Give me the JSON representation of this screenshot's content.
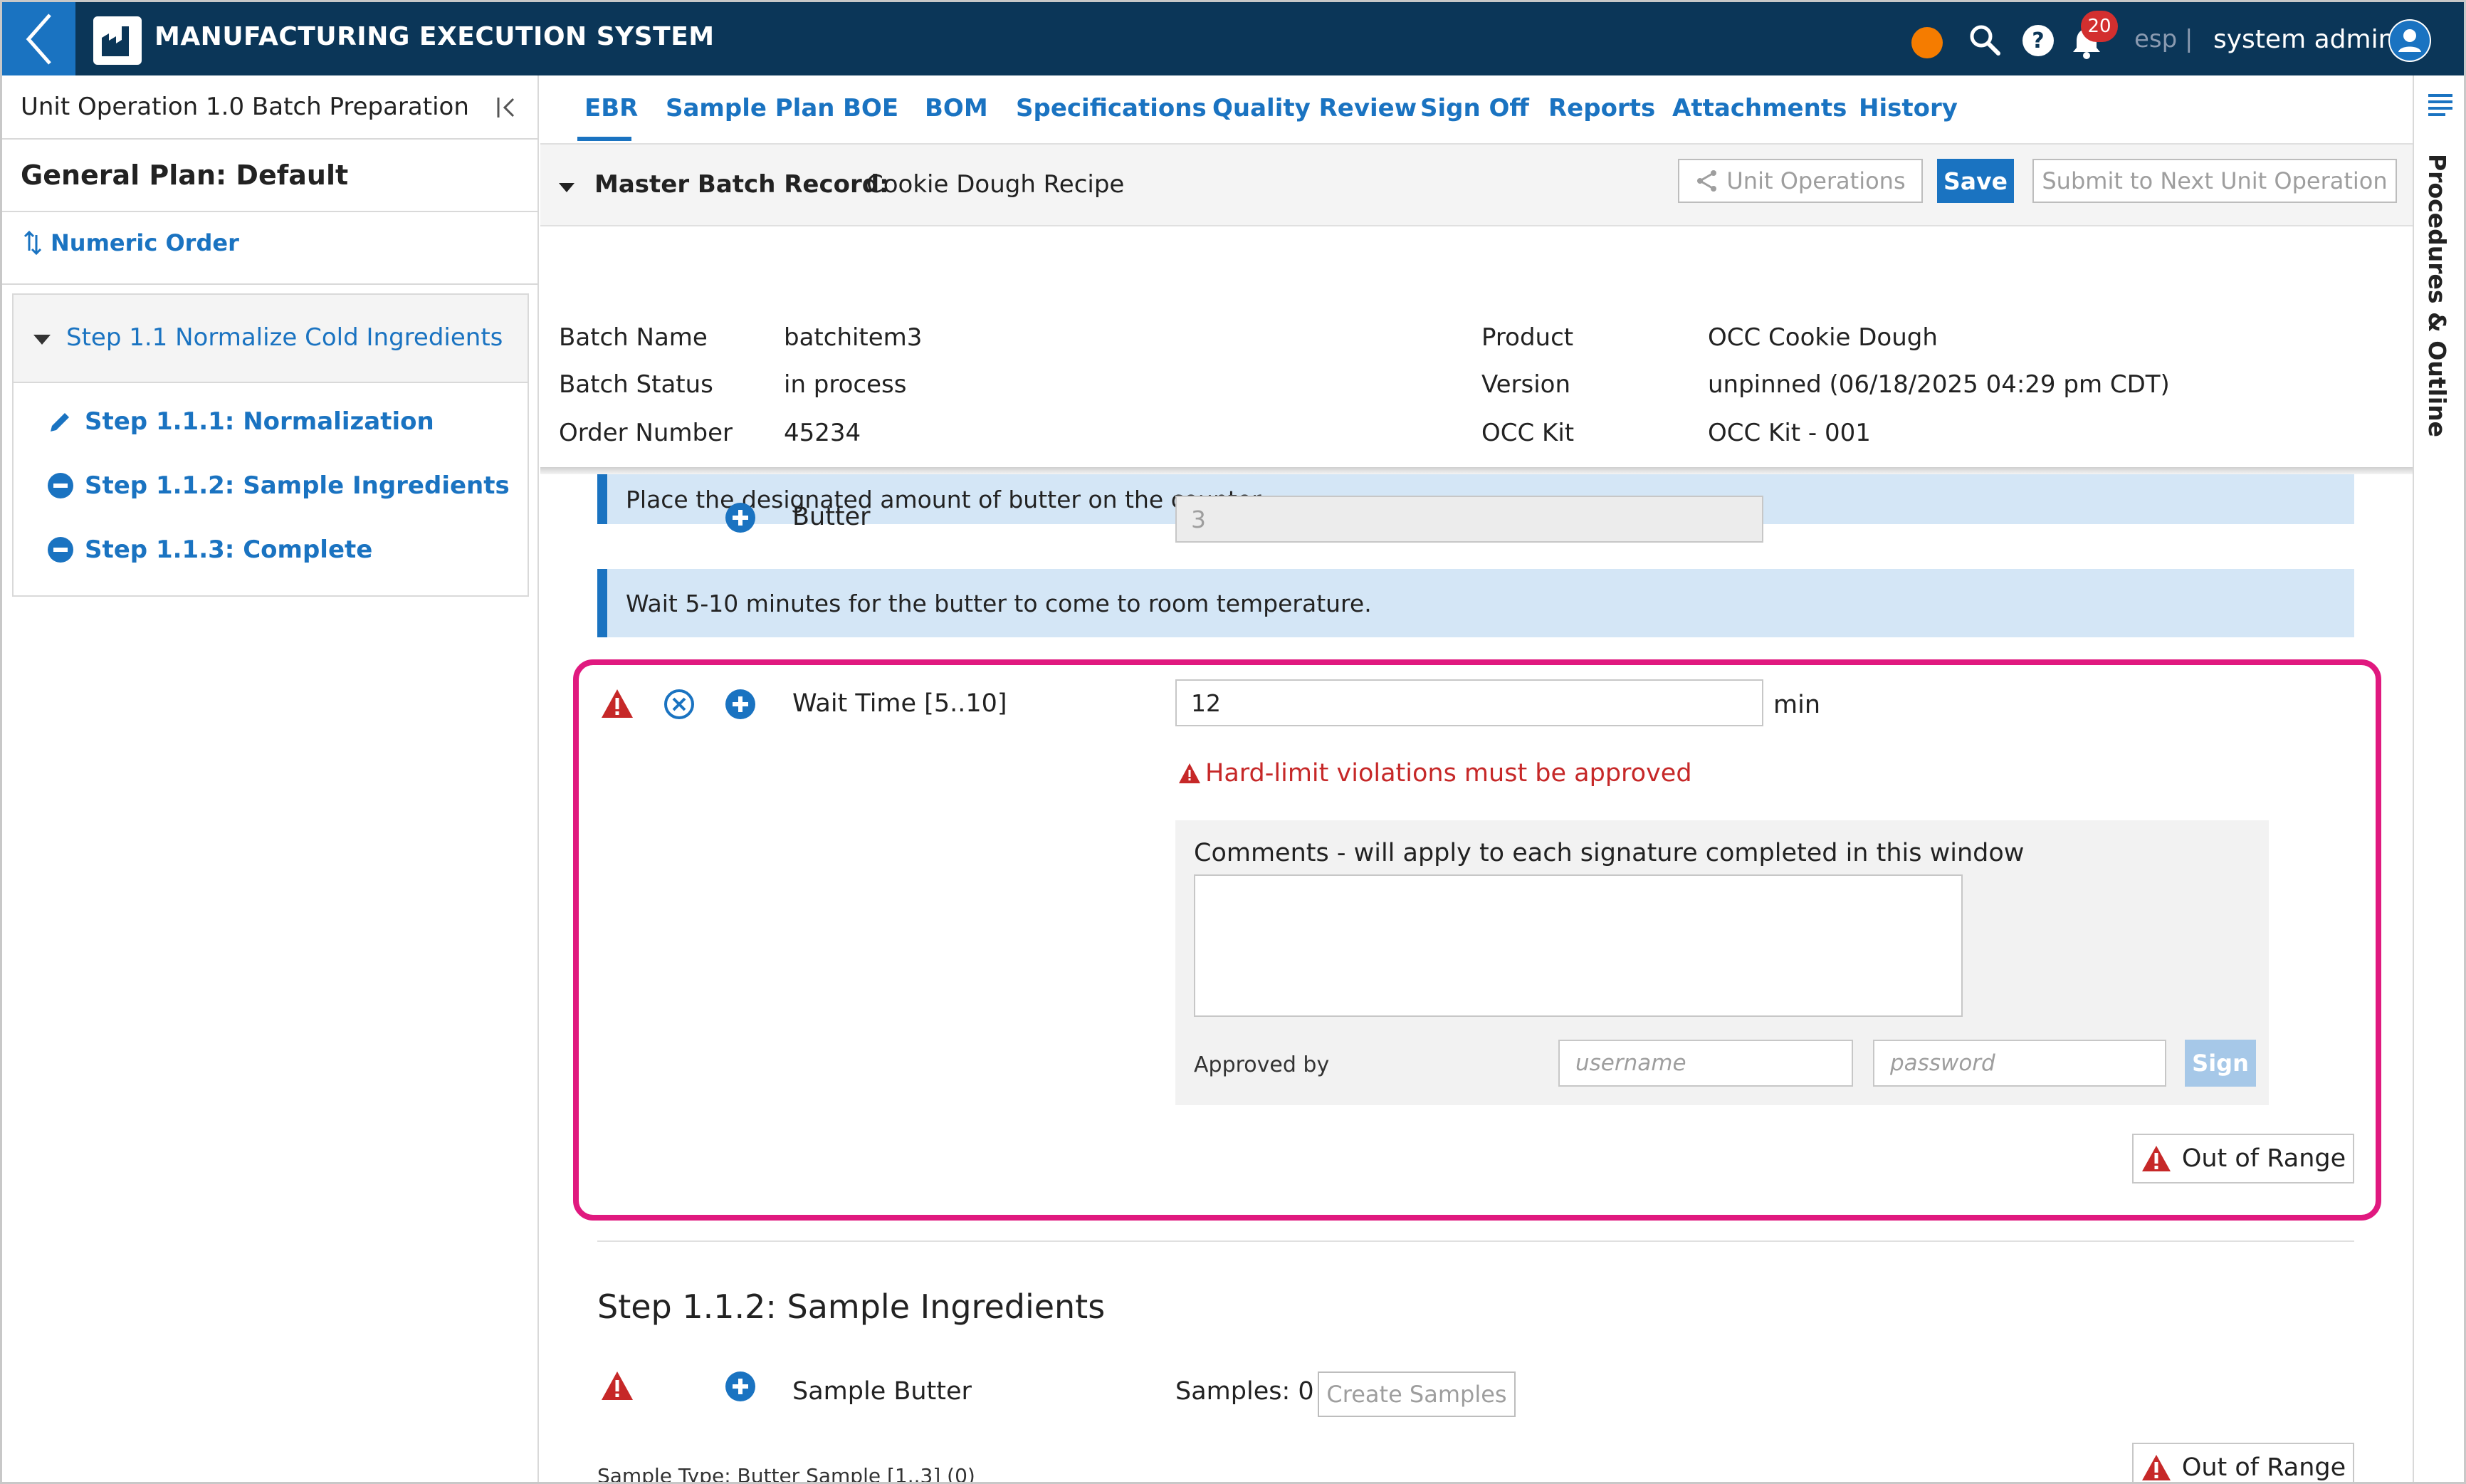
{
  "topbar": {
    "title": "MANUFACTURING EXECUTION SYSTEM",
    "notification_count": "20",
    "language": "esp |",
    "user": "system admin",
    "colors": {
      "bar": "#0b3658",
      "accent": "#1a73c1",
      "status": "#f57c00"
    }
  },
  "left_panel": {
    "header": "Unit Operation 1.0 Batch Preparation",
    "plan": "General Plan: Default",
    "order_toggle": "Numeric Order",
    "step": "Step 1.1 Normalize Cold Ingredients",
    "substeps": [
      {
        "label": "Step 1.1.1: Normalization",
        "icon": "pencil-icon"
      },
      {
        "label": "Step 1.1.2: Sample Ingredients",
        "icon": "minus-circle-icon"
      },
      {
        "label": "Step 1.1.3: Complete",
        "icon": "minus-circle-icon"
      }
    ]
  },
  "tabs": [
    "EBR",
    "Sample Plan",
    "BOE",
    "BOM",
    "Specifications",
    "Quality Review",
    "Sign Off",
    "Reports",
    "Attachments",
    "History"
  ],
  "record": {
    "label": "Master Batch Record:",
    "value": "Cookie Dough Recipe",
    "unit_operations_label": "Unit Operations",
    "save_label": "Save",
    "submit_label": "Submit to Next Unit Operation"
  },
  "info": {
    "left": [
      {
        "label": "Batch Name",
        "value": "batchitem3"
      },
      {
        "label": "Batch Status",
        "value": "in process"
      },
      {
        "label": "Order Number",
        "value": "45234"
      }
    ],
    "right": [
      {
        "label": "Product",
        "value": "OCC Cookie Dough"
      },
      {
        "label": "Version",
        "value": "unpinned (06/18/2025 04:29 pm CDT)"
      },
      {
        "label": "OCC Kit",
        "value": "OCC Kit - 001"
      }
    ]
  },
  "content": {
    "note1": "Place the designated amount of butter on the counter.",
    "butter_label": "Butter",
    "butter_value": "3",
    "note2": "Wait 5-10 minutes for the butter to come to room temperature.",
    "wait_label": "Wait Time [5..10]",
    "wait_value": "12",
    "wait_unit": "min",
    "error": "Hard-limit violations must be approved",
    "comments_label": "Comments - will apply to each signature completed in this window",
    "approved_by": "Approved by",
    "username_placeholder": "username",
    "password_placeholder": "password",
    "sign_label": "Sign",
    "out_of_range": "Out of Range",
    "section_title": "Step 1.1.2: Sample Ingredients",
    "sample_label": "Sample Butter",
    "samples_count": "Samples: 0",
    "create_samples": "Create Samples",
    "sample_type": "Sample Type: Butter Sample [1..3] (0)",
    "out_of_range_2": "Out of Range"
  },
  "right_rail": {
    "title": "Procedures & Outline"
  }
}
